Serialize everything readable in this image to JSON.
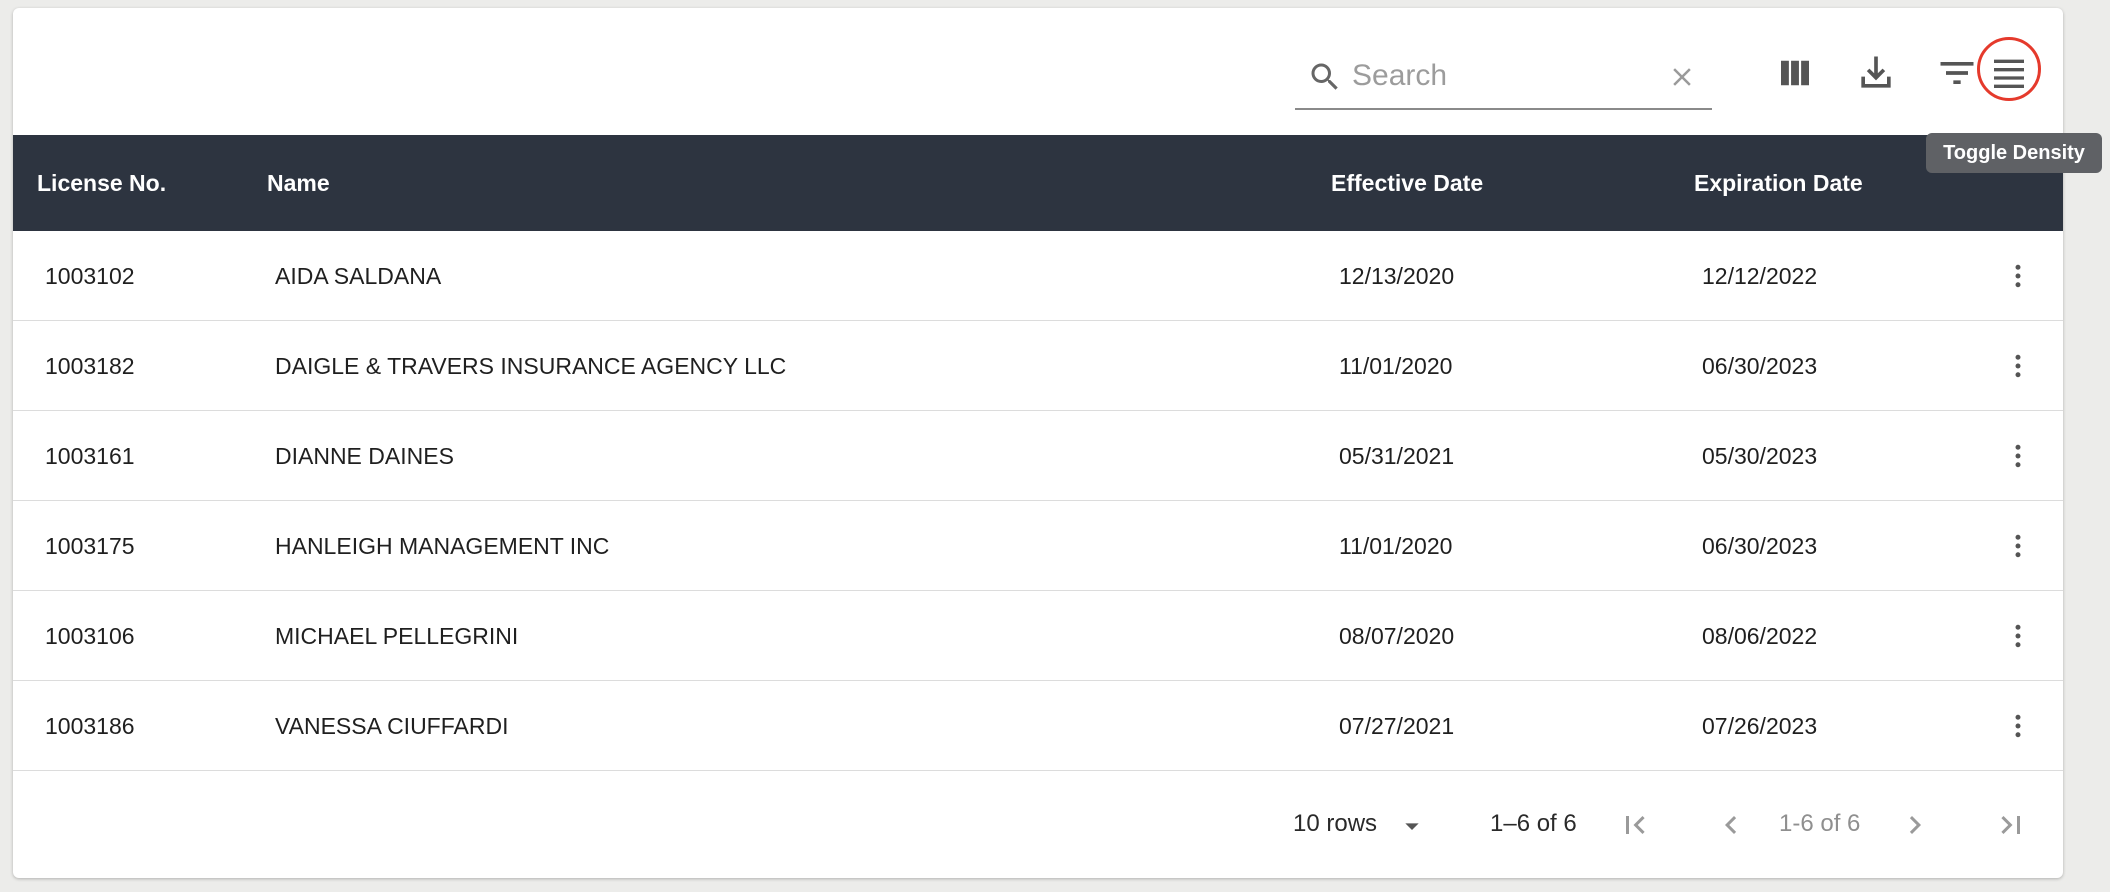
{
  "toolbar": {
    "search_placeholder": "Search",
    "search_value": "",
    "icons": {
      "search": "search-icon",
      "clear": "close-icon",
      "columns": "view-columns-icon",
      "download": "download-icon",
      "filter": "filter-list-icon",
      "density": "density-icon"
    },
    "tooltip": "Toggle Density",
    "highlight_color": "#e53a2c"
  },
  "table": {
    "header_bg": "#2d3440",
    "columns": [
      "License No.",
      "Name",
      "Effective Date",
      "Expiration Date"
    ],
    "rows": [
      [
        "1003102",
        "AIDA SALDANA",
        "12/13/2020",
        "12/12/2022"
      ],
      [
        "1003182",
        "DAIGLE & TRAVERS INSURANCE AGENCY LLC",
        "11/01/2020",
        "06/30/2023"
      ],
      [
        "1003161",
        "DIANNE DAINES",
        "05/31/2021",
        "05/30/2023"
      ],
      [
        "1003175",
        "HANLEIGH MANAGEMENT INC",
        "11/01/2020",
        "06/30/2023"
      ],
      [
        "1003106",
        "MICHAEL PELLEGRINI",
        "08/07/2020",
        "08/06/2022"
      ],
      [
        "1003186",
        "VANESSA CIUFFARDI",
        "07/27/2021",
        "07/26/2023"
      ]
    ],
    "row_action_icon": "more-vert-icon"
  },
  "footer": {
    "rows_per_page": "10 rows",
    "range": "1–6 of 6",
    "page_status": "1-6 of 6",
    "icons": {
      "rows_select": "arrow-drop-down-icon",
      "first": "first-page-icon",
      "prev": "chevron-left-icon",
      "next": "chevron-right-icon",
      "last": "last-page-icon"
    }
  }
}
